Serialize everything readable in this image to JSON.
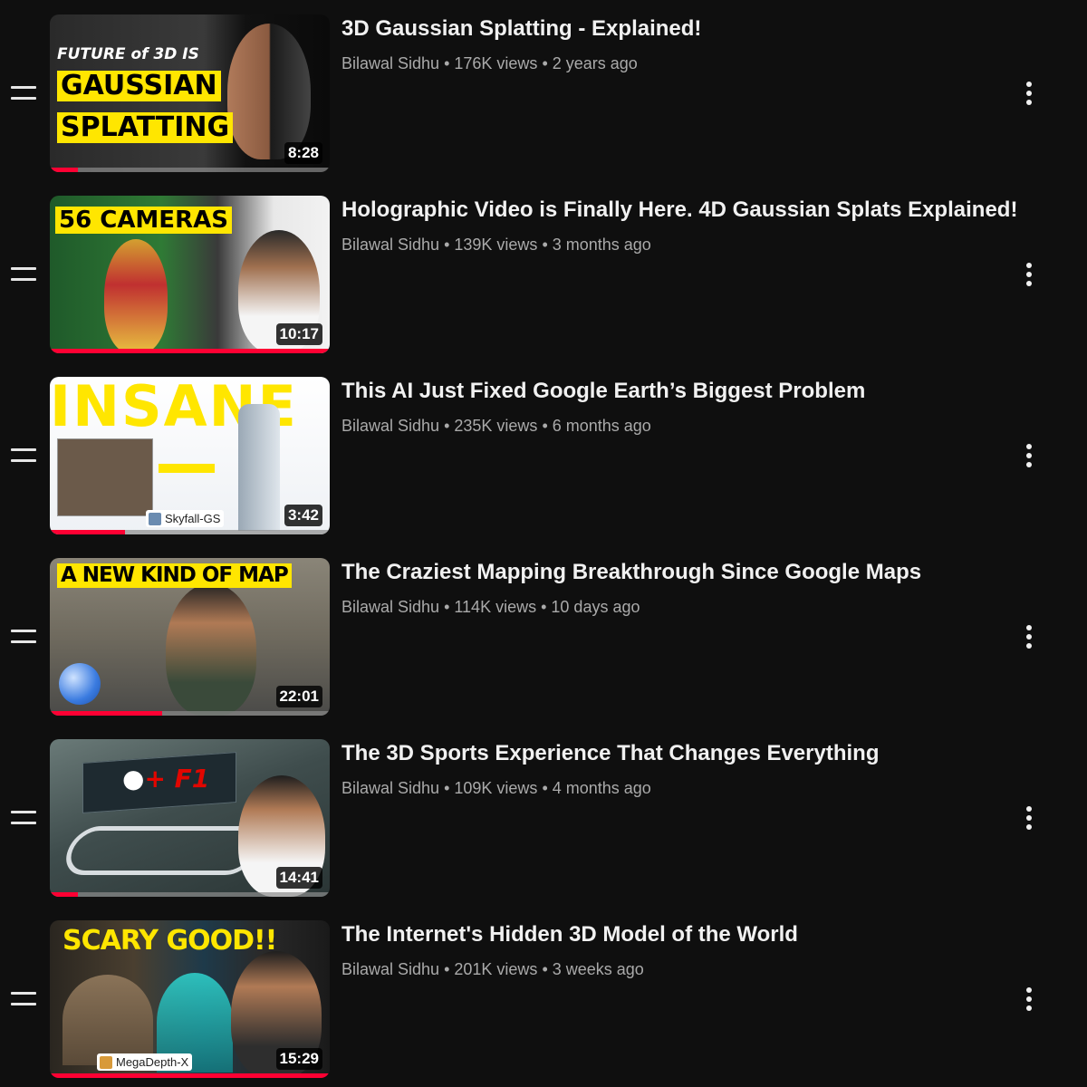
{
  "videos": [
    {
      "title": "3D Gaussian Splatting - Explained!",
      "channel": "Bilawal Sidhu",
      "views": "176K views",
      "age": "2 years ago",
      "duration": "8:28",
      "progress": 0.1,
      "thumb_lines": [
        "FUTURE of 3D IS",
        "GAUSSIAN",
        "SPLATTING"
      ]
    },
    {
      "title": "Holographic Video is Finally Here. 4D Gaussian Splats Explained!",
      "channel": "Bilawal Sidhu",
      "views": "139K views",
      "age": "3 months ago",
      "duration": "10:17",
      "progress": 1.0,
      "thumb_lines": [
        "56 CAMERAS"
      ]
    },
    {
      "title": "This AI Just Fixed Google Earth’s Biggest Problem",
      "channel": "Bilawal Sidhu",
      "views": "235K views",
      "age": "6 months ago",
      "duration": "3:42",
      "progress": 0.27,
      "thumb_lines": [
        "INSANE"
      ],
      "thumb_badge": "Skyfall-GS"
    },
    {
      "title": "The Craziest Mapping Breakthrough Since Google Maps",
      "channel": "Bilawal Sidhu",
      "views": "114K views",
      "age": "10 days ago",
      "duration": "22:01",
      "progress": 0.4,
      "thumb_lines": [
        "A NEW KIND OF MAP"
      ]
    },
    {
      "title": "The 3D Sports Experience That Changes Everything",
      "channel": "Bilawal Sidhu",
      "views": "109K views",
      "age": "4 months ago",
      "duration": "14:41",
      "progress": 0.1,
      "thumb_lines": [
        "+ F1"
      ]
    },
    {
      "title": "The Internet's Hidden 3D Model of the World",
      "channel": "Bilawal Sidhu",
      "views": "201K views",
      "age": "3 weeks ago",
      "duration": "15:29",
      "progress": 1.0,
      "thumb_lines": [
        "SCARY GOOD!!"
      ],
      "thumb_badge": "MegaDepth-X"
    }
  ],
  "colors": {
    "background": "#0f0f0f",
    "title_text": "#f1f1f1",
    "meta_text": "#aaaaaa",
    "progress_red": "#ff0033",
    "caption_yellow": "#ffe600"
  },
  "icons": {
    "drag": "drag-handle-icon",
    "more": "more-vert-icon"
  }
}
